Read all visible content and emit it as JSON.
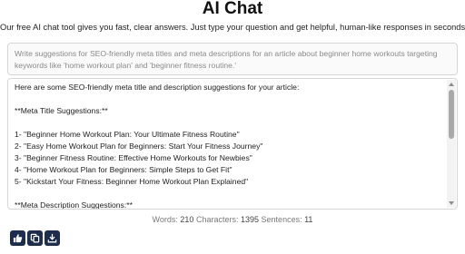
{
  "header": {
    "title": "AI Chat",
    "subtitle": "Our free AI chat tool gives you fast, clear answers. Just type your question and get helpful, human-like responses in seconds."
  },
  "prompt": {
    "value": "Write suggestions for SEO-friendly meta titles and meta descriptions for an article about beginner home workouts targeting keywords like 'home workout plan' and 'beginner fitness routine.'"
  },
  "response": {
    "lines": [
      "Here are some SEO-friendly meta title and description suggestions for your article:",
      "",
      "**Meta Title Suggestions:**",
      "",
      "1- \"Beginner Home Workout Plan: Your Ultimate Fitness Routine\"",
      "2- \"Easy Home Workout Plan for Beginners: Start Your Fitness Journey\"",
      "3- \"Beginner Fitness Routine: Effective Home Workouts for Newbies\"",
      "4- \"Home Workout Plan for Beginners: Simple Steps to Get Fit\"",
      "5- \"Kickstart Your Fitness: Beginner Home Workout Plan Explained\"",
      "",
      "**Meta Description Suggestions:**"
    ]
  },
  "stats": {
    "words_label": "Words:",
    "words": "210",
    "characters_label": "Characters:",
    "characters": "1395",
    "sentences_label": "Sentences:",
    "sentences": "11"
  },
  "actions": [
    {
      "icon": "thumbs-up-icon"
    },
    {
      "icon": "copy-icon"
    },
    {
      "icon": "download-icon"
    }
  ],
  "colors": {
    "button_bg": "#1f2d4d",
    "border": "#d6d6d6",
    "scrollbar_thumb": "#a9a9a9"
  }
}
